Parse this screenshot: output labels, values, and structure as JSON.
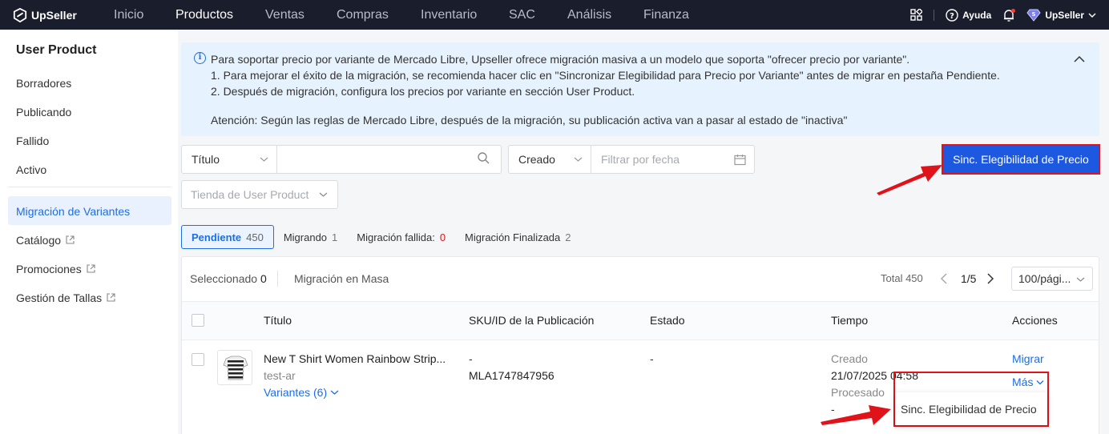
{
  "topbar": {
    "brand": "UpSeller",
    "nav": [
      "Inicio",
      "Productos",
      "Ventas",
      "Compras",
      "Inventario",
      "SAC",
      "Análisis",
      "Finanza"
    ],
    "active_nav": "Productos",
    "help_label": "Ayuda",
    "user_label": "UpSeller"
  },
  "sidebar": {
    "title": "User Product",
    "items": [
      {
        "label": "Borradores"
      },
      {
        "label": "Publicando"
      },
      {
        "label": "Fallido"
      },
      {
        "label": "Activo"
      },
      {
        "label": "Migración de Variantes"
      },
      {
        "label": "Catálogo"
      },
      {
        "label": "Promociones"
      },
      {
        "label": "Gestión de Tallas"
      }
    ]
  },
  "info": {
    "line1": "Para soportar precio por variante de Mercado Libre, Upseller ofrece migración masiva a un modelo que soporta \"ofrecer precio por variante\".",
    "line2": "1. Para mejorar el éxito de la migración, se recomienda hacer clic en \"Sincronizar Elegibilidad para Precio por Variante\" antes de migrar en pestaña Pendiente.",
    "line3": "2. Después de migración, configura los precios por variante en sección User Product.",
    "line4": "Atención: Según las reglas de Mercado Libre, después de la migración, su publicación activa van a pasar al estado de \"inactiva\""
  },
  "filters": {
    "title_select": "Título",
    "date_select": "Creado",
    "date_placeholder": "Filtrar por fecha",
    "store_placeholder": "Tienda de User Product"
  },
  "sync_button": "Sinc. Elegibilidad de Precio",
  "tabs": [
    {
      "label": "Pendiente",
      "count": "450"
    },
    {
      "label": "Migrando",
      "count": "1"
    },
    {
      "label": "Migración fallida:",
      "count": "0"
    },
    {
      "label": "Migración Finalizada",
      "count": "2"
    }
  ],
  "toolbar": {
    "selected_label": "Seleccionado",
    "selected_count": "0",
    "mass_migrate": "Migración en Masa",
    "total": "Total 450",
    "page": "1/5",
    "page_size": "100/pági..."
  },
  "table": {
    "headers": [
      "Título",
      "SKU/ID de la Publicación",
      "Estado",
      "Tiempo",
      "Acciones"
    ],
    "row": {
      "title": "New T Shirt Women Rainbow Strip...",
      "store": "test-ar",
      "variants": "Variantes (6)",
      "sku": "-",
      "item_id": "MLA1747847956",
      "status": "-",
      "created_label": "Creado",
      "created_value": "21/07/2025 04:58",
      "processed_label": "Procesado",
      "processed_value": "-",
      "action_migrate": "Migrar",
      "action_more": "Más"
    },
    "dropdown_item": "Sinc. Elegibilidad de Precio"
  },
  "colors": {
    "accent": "#1d6ee6",
    "primary_button": "#1d58e0",
    "highlight": "#e0121a",
    "topbar": "#1a1d2b"
  }
}
